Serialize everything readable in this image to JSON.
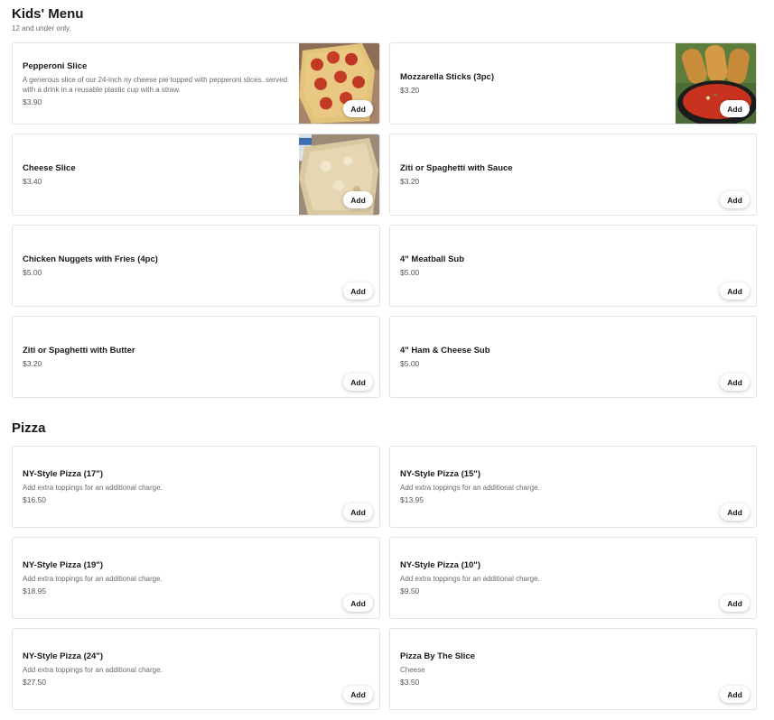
{
  "kids_menu": {
    "title": "Kids' Menu",
    "subtitle": "12 and under only.",
    "items": [
      {
        "name": "Pepperoni Slice",
        "description": "A generous slice of our 24-inch ny cheese pie topped with pepperoni slices. served with a drink in a reusable plastic cup with a straw.",
        "price": "$3.90",
        "add": "Add"
      },
      {
        "name": "Mozzarella Sticks (3pc)",
        "description": "",
        "price": "$3.20",
        "add": "Add"
      },
      {
        "name": "Cheese Slice",
        "description": "",
        "price": "$3.40",
        "add": "Add"
      },
      {
        "name": "Ziti or Spaghetti with Sauce",
        "description": "",
        "price": "$3.20",
        "add": "Add"
      },
      {
        "name": "Chicken Nuggets with Fries (4pc)",
        "description": "",
        "price": "$5.00",
        "add": "Add"
      },
      {
        "name": "4\" Meatball Sub",
        "description": "",
        "price": "$5.00",
        "add": "Add"
      },
      {
        "name": "Ziti or Spaghetti with Butter",
        "description": "",
        "price": "$3.20",
        "add": "Add"
      },
      {
        "name": "4\" Ham & Cheese Sub",
        "description": "",
        "price": "$5.00",
        "add": "Add"
      }
    ]
  },
  "pizza": {
    "title": "Pizza",
    "items": [
      {
        "name": "NY-Style Pizza (17\")",
        "description": "Add extra toppings for an additional charge.",
        "price": "$16.50",
        "add": "Add"
      },
      {
        "name": "NY-Style Pizza (15\")",
        "description": "Add extra toppings for an additional charge.",
        "price": "$13.95",
        "add": "Add"
      },
      {
        "name": "NY-Style Pizza (19\")",
        "description": "Add extra toppings for an additional charge.",
        "price": "$18.95",
        "add": "Add"
      },
      {
        "name": "NY-Style Pizza (10\")",
        "description": "Add extra toppings for an additional charge.",
        "price": "$9.50",
        "add": "Add"
      },
      {
        "name": "NY-Style Pizza (24\")",
        "description": "Add extra toppings for an additional charge.",
        "price": "$27.50",
        "add": "Add"
      },
      {
        "name": "Pizza By The Slice",
        "description": "Cheese",
        "price": "$3.50",
        "add": "Add"
      }
    ]
  }
}
